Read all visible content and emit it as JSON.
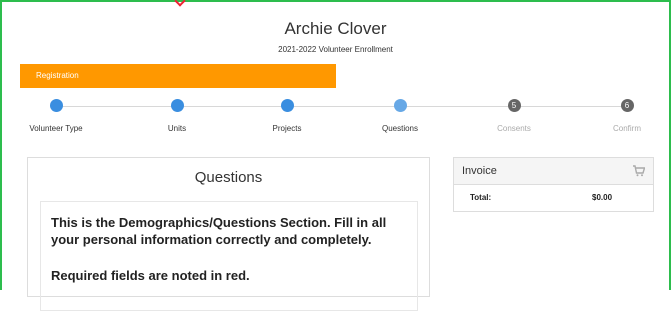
{
  "header": {
    "title": "Archie Clover",
    "subtitle": "2021-2022 Volunteer Enrollment"
  },
  "progress": {
    "label": "Registration",
    "accent": "#ff9800"
  },
  "steps": [
    {
      "number": "",
      "label": "Volunteer Type",
      "state": "complete"
    },
    {
      "number": "",
      "label": "Units",
      "state": "complete"
    },
    {
      "number": "",
      "label": "Projects",
      "state": "complete"
    },
    {
      "number": "",
      "label": "Questions",
      "state": "current"
    },
    {
      "number": "5",
      "label": "Consents",
      "state": "upcoming"
    },
    {
      "number": "6",
      "label": "Confirm",
      "state": "upcoming"
    }
  ],
  "questions": {
    "title": "Questions",
    "intro": "This is the Demographics/Questions Section.   Fill in all your personal information correctly and completely.",
    "required_note": "Required fields are noted in red."
  },
  "invoice": {
    "title": "Invoice",
    "total_label": "Total:",
    "total_value": "$0.00",
    "icon": "cart-icon"
  },
  "colors": {
    "frame": "#2dbd4d",
    "step_done": "#3a8ee0",
    "step_todo": "#666666"
  }
}
